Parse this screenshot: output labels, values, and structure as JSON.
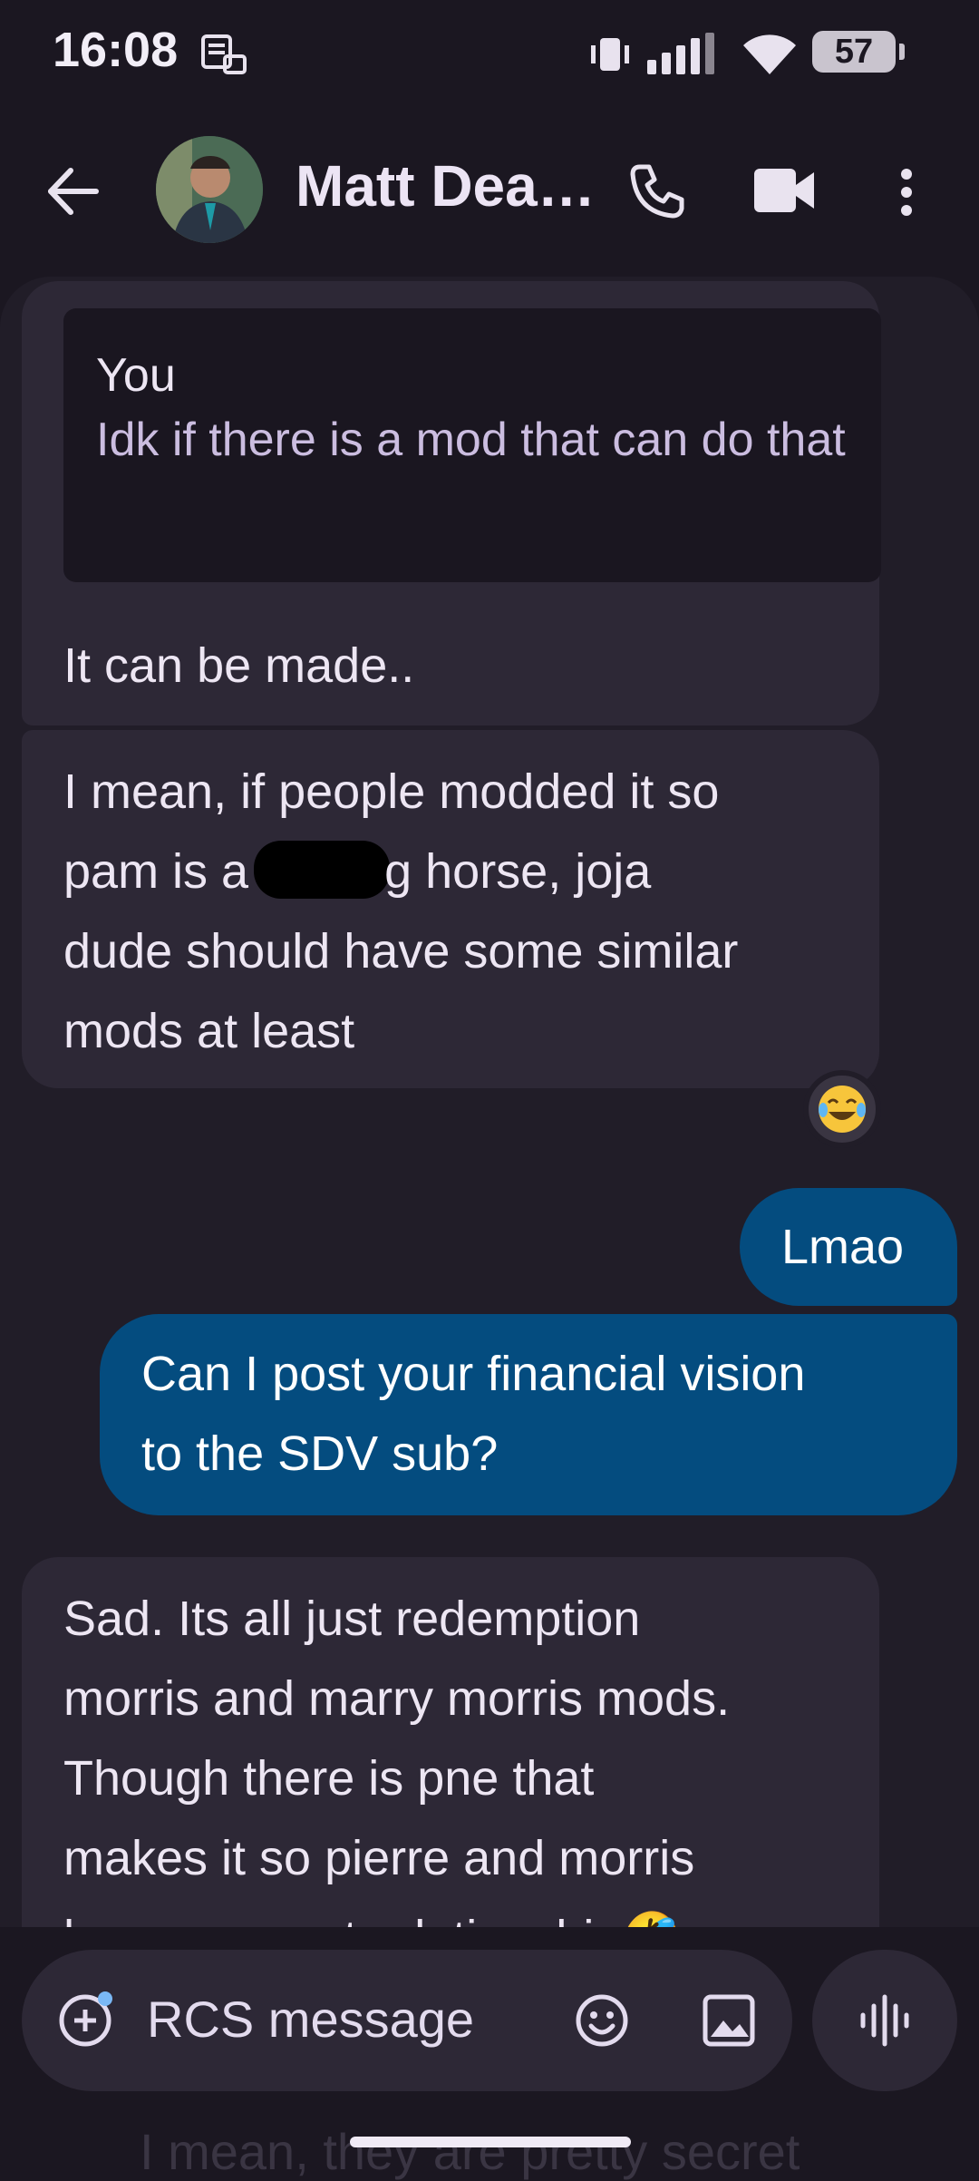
{
  "status_bar": {
    "time": "16:08",
    "battery": "57"
  },
  "header": {
    "contact_name": "Matt Dea…"
  },
  "messages": {
    "m1": {
      "reply_sender": "You",
      "reply_quote": "Idk if there is a mod that can do that",
      "text": "It can be made.."
    },
    "m2": {
      "line1": "I mean, if people modded it so",
      "line2_a": "pam is a f",
      "line2_b": "g horse, joja",
      "line3": "dude should have some similar",
      "line4": "mods at least",
      "reaction": "😂"
    },
    "m3": {
      "text": "Lmao"
    },
    "m4": {
      "line1": "Can I post your financial vision",
      "line2": "to the SDV sub?"
    },
    "m5": {
      "line1": "Sad. Its all just redemption",
      "line2": "morris and marry morris mods.",
      "line3": "Though there is pne that",
      "line4": "makes it so pierre and morris",
      "line5": "have a secret relationship🤣"
    }
  },
  "composer": {
    "placeholder": "RCS message"
  },
  "ghost_text": "I mean, they are pretty secret",
  "colors": {
    "background": "#1b1721",
    "incoming_bubble": "#2d2836",
    "outgoing_bubble": "#044c7f",
    "quote_text": "#cbbde0"
  }
}
